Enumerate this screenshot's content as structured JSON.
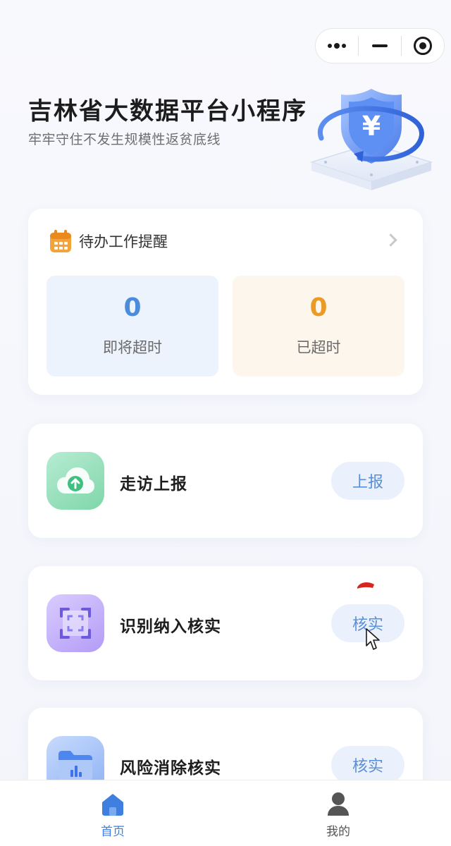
{
  "colors": {
    "accent": "#3f7fe0",
    "soon_number": "#4a8bdc",
    "overdue_number": "#eb9a26",
    "button_bg": "#eaf1fc",
    "button_text": "#5a8fd6"
  },
  "capsule": {
    "icons": [
      "more-dots-icon",
      "minimize-icon",
      "close-target-icon"
    ]
  },
  "header": {
    "title": "吉林省大数据平台小程序",
    "subtitle": "牢牢守住不发生规模性返贫底线",
    "illustration_icon": "yuan-shield-icon"
  },
  "todo": {
    "title": "待办工作提醒",
    "icon": "calendar-icon",
    "soon": {
      "value": "0",
      "label": "即将超时"
    },
    "overdue": {
      "value": "0",
      "label": "已超时"
    }
  },
  "actions": [
    {
      "title": "走访上报",
      "button": "上报",
      "icon": "cloud-upload-icon"
    },
    {
      "title": "识别纳入核实",
      "button": "核实",
      "icon": "scan-frame-icon"
    },
    {
      "title": "风险消除核实",
      "button": "核实",
      "icon": "folder-chart-icon"
    }
  ],
  "tabbar": {
    "tabs": [
      {
        "label": "首页",
        "icon": "home-icon",
        "active": true
      },
      {
        "label": "我的",
        "icon": "user-icon",
        "active": false
      }
    ]
  }
}
